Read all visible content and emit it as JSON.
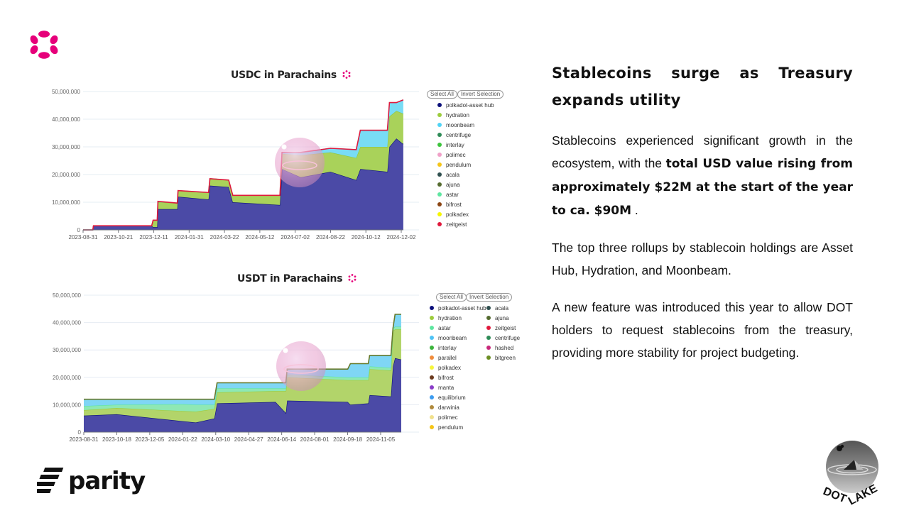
{
  "slide": {
    "heading": "Stablecoins surge as Treasury expands utility",
    "paragraph1": {
      "plain": "Stablecoins experienced significant growth in the ecosystem, with the ",
      "bold": "total USD value  rising from approximately $22M at the start of the year to ca. $90M",
      "end": "  ."
    },
    "paragraph2": "The top three rollups by stablecoin holdings are Asset Hub, Hydration, and Moonbeam.",
    "paragraph3": "A new feature was introduced this year to allow DOT holders to request stablecoins from the treasury, providing more stability for project budgeting.",
    "parity_logo_text": "parity",
    "dotlake_logo_text": "DOTLAKE",
    "accent_color": "#e6007a"
  },
  "chart_data": [
    {
      "type": "area",
      "stacked": true,
      "title": "USDC in Parachains",
      "ylim": [
        0,
        50000000
      ],
      "y_ticks": [
        "0",
        "10,000,000",
        "20,000,000",
        "30,000,000",
        "40,000,000",
        "50,000,000"
      ],
      "x_ticks": [
        "2023-08-31",
        "2023-10-21",
        "2023-12-11",
        "2024-01-31",
        "2024-03-22",
        "2024-05-12",
        "2024-07-02",
        "2024-08-22",
        "2024-10-12",
        "2024-12-02"
      ],
      "grid": true,
      "legend_placement": "right",
      "legend_buttons": [
        "Select All",
        "Invert Selection"
      ],
      "legend": [
        {
          "name": "polkadot-asset hub",
          "color": "#0b0f7a"
        },
        {
          "name": "hydration",
          "color": "#9ccc3c"
        },
        {
          "name": "moonbeam",
          "color": "#4fd3f5"
        },
        {
          "name": "centrifuge",
          "color": "#2e8b57"
        },
        {
          "name": "interlay",
          "color": "#3cc43c"
        },
        {
          "name": "polimec",
          "color": "#f0a0c8"
        },
        {
          "name": "pendulum",
          "color": "#f5c518"
        },
        {
          "name": "acala",
          "color": "#2f4f4f"
        },
        {
          "name": "ajuna",
          "color": "#556b2f"
        },
        {
          "name": "astar",
          "color": "#5ee6a0"
        },
        {
          "name": "bifrost",
          "color": "#8b4513"
        },
        {
          "name": "polkadex",
          "color": "#f5f500"
        },
        {
          "name": "zeitgeist",
          "color": "#e0193c"
        }
      ],
      "x": [
        "2023-08-31",
        "2023-09-14",
        "2023-09-15",
        "2023-12-08",
        "2023-12-10",
        "2023-12-16",
        "2023-12-17",
        "2024-01-14",
        "2024-01-15",
        "2024-02-28",
        "2024-03-01",
        "2024-03-28",
        "2024-04-03",
        "2024-06-10",
        "2024-06-13",
        "2024-07-10",
        "2024-08-22",
        "2024-09-28",
        "2024-10-04",
        "2024-11-12",
        "2024-11-15",
        "2024-11-25",
        "2024-12-05"
      ],
      "series": [
        {
          "name": "polkadot-asset hub",
          "color": "#4b4aa6",
          "line": "#0b0f7a",
          "values": [
            0,
            0,
            1500000,
            1500000,
            1000000,
            1000000,
            7500000,
            7500000,
            12000000,
            11000000,
            16000000,
            15500000,
            10000000,
            9000000,
            22000000,
            19000000,
            21000000,
            18000000,
            22000000,
            21000000,
            30000000,
            33000000,
            31000000
          ]
        },
        {
          "name": "hydration",
          "color": "#a9d25a",
          "line": "#8cc63f",
          "values": [
            0,
            0,
            0,
            0,
            2500000,
            2500000,
            2500000,
            2200000,
            2200000,
            2500000,
            2500000,
            2500000,
            2500000,
            3500000,
            5500000,
            8000000,
            7000000,
            8000000,
            8000000,
            9000000,
            11000000,
            10000000,
            11000000
          ]
        },
        {
          "name": "moonbeam",
          "color": "#78dcf5",
          "line": "#4fd3f5",
          "values": [
            0,
            0,
            0,
            0,
            0,
            0,
            300000,
            0,
            0,
            0,
            0,
            0,
            0,
            0,
            500000,
            1000000,
            1500000,
            3000000,
            6000000,
            6000000,
            5000000,
            3000000,
            5000000
          ]
        }
      ],
      "total_line_color": "#e0193c"
    },
    {
      "type": "area",
      "stacked": true,
      "title": "USDT in Parachains",
      "ylim": [
        0,
        50000000
      ],
      "y_ticks": [
        "0",
        "10,000,000",
        "20,000,000",
        "30,000,000",
        "40,000,000",
        "50,000,000"
      ],
      "x_ticks": [
        "2023-08-31",
        "2023-10-18",
        "2023-12-05",
        "2024-01-22",
        "2024-03-10",
        "2024-04-27",
        "2024-06-14",
        "2024-08-01",
        "2024-09-18",
        "2024-11-05"
      ],
      "grid": true,
      "legend_placement": "right",
      "legend_buttons": [
        "Select All",
        "Invert Selection"
      ],
      "legend": [
        {
          "name": "polkadot-asset hub",
          "color": "#0b0f7a"
        },
        {
          "name": "hydration",
          "color": "#9ccc3c"
        },
        {
          "name": "astar",
          "color": "#5ee6a0"
        },
        {
          "name": "moonbeam",
          "color": "#4fc3f5"
        },
        {
          "name": "interlay",
          "color": "#3cb43c"
        },
        {
          "name": "parallel",
          "color": "#f08c3c"
        },
        {
          "name": "polkadex",
          "color": "#f5f53c"
        },
        {
          "name": "bifrost",
          "color": "#6b3a1e"
        },
        {
          "name": "manta",
          "color": "#8a3cc8"
        },
        {
          "name": "equilibrium",
          "color": "#3c9cf0"
        },
        {
          "name": "darwinia",
          "color": "#b08a3c"
        },
        {
          "name": "polimec",
          "color": "#f0e08c"
        },
        {
          "name": "pendulum",
          "color": "#f5c518"
        },
        {
          "name": "acala",
          "color": "#2f4f4f"
        },
        {
          "name": "ajuna",
          "color": "#556b2f"
        },
        {
          "name": "zeitgeist",
          "color": "#e0193c"
        },
        {
          "name": "centrifuge",
          "color": "#2e8b57"
        },
        {
          "name": "hashed",
          "color": "#c8287a"
        },
        {
          "name": "bitgreen",
          "color": "#6b8e23"
        }
      ],
      "x": [
        "2023-08-31",
        "2023-10-18",
        "2024-01-22",
        "2024-02-10",
        "2024-03-08",
        "2024-03-12",
        "2024-06-05",
        "2024-06-20",
        "2024-06-22",
        "2024-09-18",
        "2024-09-22",
        "2024-10-18",
        "2024-10-20",
        "2024-11-20",
        "2024-11-23",
        "2024-11-26",
        "2024-12-05"
      ],
      "series": [
        {
          "name": "polkadot-asset hub",
          "color": "#4b4aa6",
          "line": "#0b0f7a",
          "values": [
            6000000,
            6500000,
            4000000,
            3500000,
            5000000,
            10500000,
            11000000,
            7000000,
            11500000,
            11000000,
            10000000,
            10500000,
            13500000,
            13000000,
            24000000,
            27000000,
            26500000
          ]
        },
        {
          "name": "hydration",
          "color": "#b2d46a",
          "line": "#9ccc3c",
          "values": [
            2000000,
            2300000,
            3700000,
            4000000,
            3500000,
            4000000,
            4000000,
            8000000,
            8500000,
            8000000,
            9000000,
            8500000,
            9500000,
            9500000,
            13000000,
            10500000,
            11000000
          ]
        },
        {
          "name": "astar",
          "color": "#8ee8b4",
          "line": "#5ee6a0",
          "values": [
            1500000,
            1200000,
            2500000,
            2500000,
            1500000,
            1500000,
            1000000,
            1000000,
            1000000,
            1000000,
            1000000,
            1000000,
            1000000,
            1000000,
            1000000,
            1000000,
            1000000
          ]
        },
        {
          "name": "moonbeam",
          "color": "#7fd6f5",
          "line": "#4fc3f5",
          "values": [
            2500000,
            2000000,
            1800000,
            2000000,
            2000000,
            2000000,
            2000000,
            2000000,
            2000000,
            3000000,
            5000000,
            5000000,
            4000000,
            4500000,
            0,
            4500000,
            4500000
          ]
        }
      ],
      "total_line_color": "#6b7a2a"
    }
  ]
}
